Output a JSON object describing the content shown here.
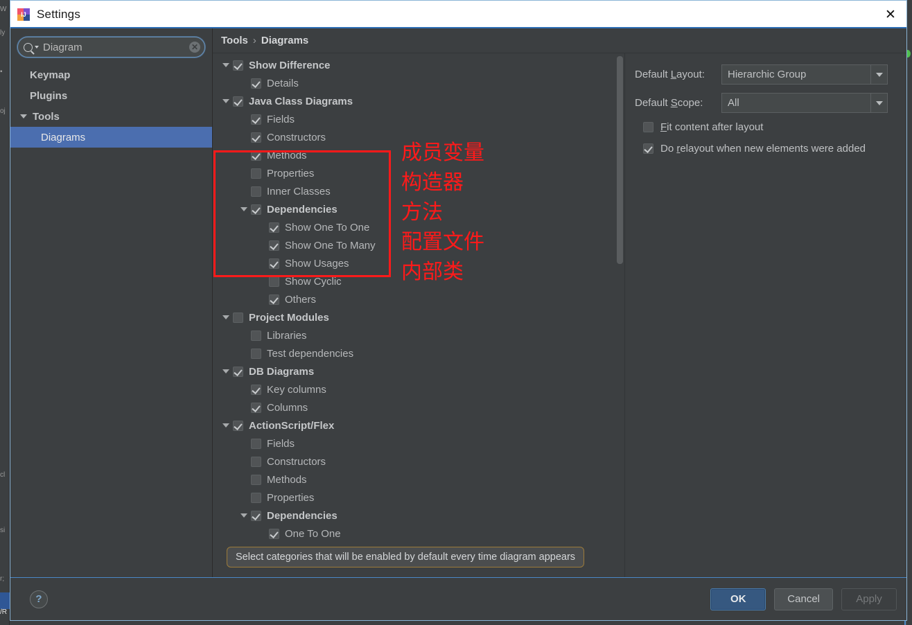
{
  "window": {
    "title": "Settings",
    "icon": "intellij-idea-icon",
    "close_label": "✕"
  },
  "search": {
    "value": "Diagram",
    "placeholder": "Search settings",
    "icon": "search-icon",
    "clear_label": "✕"
  },
  "sidebar": {
    "items": [
      {
        "label": "Keymap",
        "level": "top",
        "selected": false,
        "expandable": false
      },
      {
        "label": "Plugins",
        "level": "top",
        "selected": false,
        "expandable": false
      },
      {
        "label": "Tools",
        "level": "group",
        "selected": false,
        "expandable": true
      },
      {
        "label": "Diagrams",
        "level": "child",
        "selected": true,
        "expandable": false
      }
    ]
  },
  "breadcrumb": {
    "root": "Tools",
    "separator": "›",
    "current": "Diagrams"
  },
  "tree": {
    "rows": [
      {
        "label": "Show Difference",
        "indent": 0,
        "twisty": true,
        "checked": true,
        "bold": true
      },
      {
        "label": "Details",
        "indent": 1,
        "twisty": false,
        "checked": true,
        "bold": false
      },
      {
        "label": "Java Class Diagrams",
        "indent": 0,
        "twisty": true,
        "checked": true,
        "bold": true
      },
      {
        "label": "Fields",
        "indent": 1,
        "twisty": false,
        "checked": true,
        "bold": false
      },
      {
        "label": "Constructors",
        "indent": 1,
        "twisty": false,
        "checked": true,
        "bold": false
      },
      {
        "label": "Methods",
        "indent": 1,
        "twisty": false,
        "checked": true,
        "bold": false
      },
      {
        "label": "Properties",
        "indent": 1,
        "twisty": false,
        "checked": false,
        "bold": false
      },
      {
        "label": "Inner Classes",
        "indent": 1,
        "twisty": false,
        "checked": false,
        "bold": false
      },
      {
        "label": "Dependencies",
        "indent": 1,
        "twisty": true,
        "checked": true,
        "bold": true
      },
      {
        "label": "Show One To One",
        "indent": 2,
        "twisty": false,
        "checked": true,
        "bold": false
      },
      {
        "label": "Show One To Many",
        "indent": 2,
        "twisty": false,
        "checked": true,
        "bold": false
      },
      {
        "label": "Show Usages",
        "indent": 2,
        "twisty": false,
        "checked": true,
        "bold": false
      },
      {
        "label": "Show Cyclic",
        "indent": 2,
        "twisty": false,
        "checked": false,
        "bold": false
      },
      {
        "label": "Others",
        "indent": 2,
        "twisty": false,
        "checked": true,
        "bold": false
      },
      {
        "label": "Project Modules",
        "indent": 0,
        "twisty": true,
        "checked": false,
        "bold": true
      },
      {
        "label": "Libraries",
        "indent": 1,
        "twisty": false,
        "checked": false,
        "bold": false
      },
      {
        "label": "Test dependencies",
        "indent": 1,
        "twisty": false,
        "checked": false,
        "bold": false
      },
      {
        "label": "DB Diagrams",
        "indent": 0,
        "twisty": true,
        "checked": true,
        "bold": true
      },
      {
        "label": "Key columns",
        "indent": 1,
        "twisty": false,
        "checked": true,
        "bold": false
      },
      {
        "label": "Columns",
        "indent": 1,
        "twisty": false,
        "checked": true,
        "bold": false
      },
      {
        "label": "ActionScript/Flex",
        "indent": 0,
        "twisty": true,
        "checked": true,
        "bold": true
      },
      {
        "label": "Fields",
        "indent": 1,
        "twisty": false,
        "checked": false,
        "bold": false
      },
      {
        "label": "Constructors",
        "indent": 1,
        "twisty": false,
        "checked": false,
        "bold": false
      },
      {
        "label": "Methods",
        "indent": 1,
        "twisty": false,
        "checked": false,
        "bold": false
      },
      {
        "label": "Properties",
        "indent": 1,
        "twisty": false,
        "checked": false,
        "bold": false
      },
      {
        "label": "Dependencies",
        "indent": 1,
        "twisty": true,
        "checked": true,
        "bold": true
      },
      {
        "label": "One To One",
        "indent": 2,
        "twisty": false,
        "checked": true,
        "bold": false
      }
    ]
  },
  "annotation": {
    "color": "#ff1a1a",
    "lines": [
      "成员变量",
      "构造器",
      "方法",
      "配置文件",
      "内部类"
    ]
  },
  "tooltip": {
    "text": "Select categories that will be enabled by default every time diagram appears"
  },
  "options": {
    "default_layout": {
      "label_prefix": "Default ",
      "label_mnemonic": "L",
      "label_suffix": "ayout:",
      "value": "Hierarchic Group"
    },
    "default_scope": {
      "label_prefix": "Default ",
      "label_mnemonic": "S",
      "label_suffix": "cope:",
      "value": "All"
    },
    "fit_content": {
      "label_prefix": "",
      "label_mnemonic": "F",
      "label_suffix": "it content after layout",
      "checked": false
    },
    "do_relayout": {
      "label_prefix": "Do ",
      "label_mnemonic": "r",
      "label_suffix": "elayout when new elements were added",
      "checked": true
    }
  },
  "footer": {
    "help_label": "?",
    "ok_label": "OK",
    "cancel_label": "Cancel",
    "apply_label": "Apply"
  },
  "colors": {
    "accent": "#4b6eaf",
    "annotation_red": "#ff1a1a",
    "tooltip_border": "#9c7b3a",
    "panel_bg": "#3c3f41"
  }
}
